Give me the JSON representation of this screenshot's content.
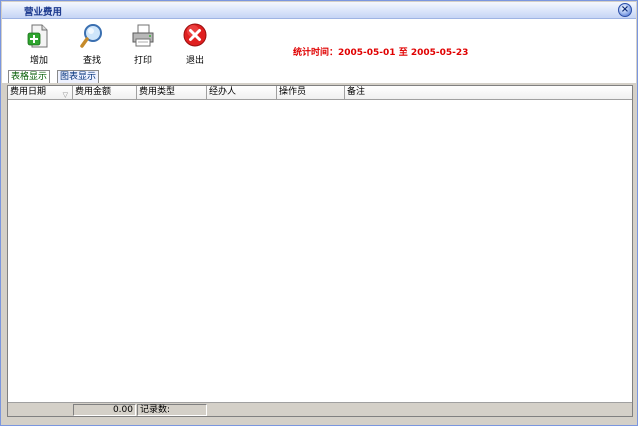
{
  "window": {
    "title": "营业费用"
  },
  "toolbar": {
    "add_label": "增加",
    "find_label": "查找",
    "print_label": "打印",
    "exit_label": "退出"
  },
  "stat": {
    "text": "统计时间：2005-05-01 至 2005-05-23"
  },
  "tabs": [
    {
      "label": "表格显示"
    },
    {
      "label": "图表显示"
    }
  ],
  "grid": {
    "columns": [
      "费用日期",
      "费用金额",
      "费用类型",
      "经办人",
      "操作员",
      "备注"
    ]
  },
  "footer": {
    "total": "0.00",
    "count_label": "记录数:"
  },
  "colors": {
    "stat_text": "#e00000",
    "active_tab_text": "#005a00",
    "inactive_tab_text": "#00307a",
    "exit_icon": "#e02020"
  },
  "icons": {
    "add": "document-plus-icon",
    "find": "magnifier-icon",
    "print": "printer-icon",
    "exit": "close-circle-icon",
    "close": "window-close-icon",
    "sort": "sort-down-icon"
  }
}
